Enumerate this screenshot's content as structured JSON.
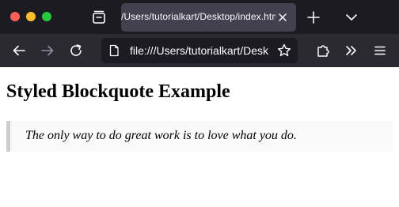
{
  "browser": {
    "tab": {
      "title": "/Users/tutorialkart/Desktop/index.html"
    },
    "address_bar": {
      "url": "file:///Users/tutorialkart/Desktop/index.html"
    }
  },
  "icons": {
    "tab_manager": "tab-manager-icon",
    "close_tab": "close-icon",
    "new_tab": "plus-icon",
    "tab_list": "chevron-down-icon",
    "back": "arrow-left-icon",
    "forward": "arrow-right-icon",
    "reload": "reload-icon",
    "page": "page-icon",
    "bookmark": "star-icon",
    "extensions": "puzzle-icon",
    "overflow": "double-chevron-icon",
    "menu": "hamburger-icon"
  },
  "page": {
    "heading": "Styled Blockquote Example",
    "blockquote": "The only way to do great work is to love what you do."
  },
  "colors": {
    "tabbar_bg": "#1c1b22",
    "toolbar_bg": "#2b2a33",
    "active_tab_bg": "#42414d",
    "blockquote_bg": "#f9f9f9",
    "blockquote_border": "#cccccc"
  }
}
